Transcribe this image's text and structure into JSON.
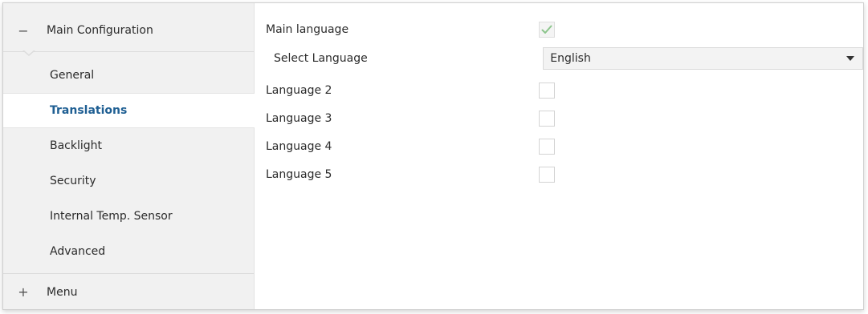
{
  "sidebar": {
    "main_group": {
      "sign": "−",
      "label": "Main Configuration"
    },
    "items": [
      {
        "label": "General",
        "active": false
      },
      {
        "label": "Translations",
        "active": true
      },
      {
        "label": "Backlight",
        "active": false
      },
      {
        "label": "Security",
        "active": false
      },
      {
        "label": "Internal Temp. Sensor",
        "active": false
      },
      {
        "label": "Advanced",
        "active": false
      }
    ],
    "menu_group": {
      "sign": "+",
      "label": "Menu"
    }
  },
  "content": {
    "main_language": {
      "label": "Main language",
      "checked": true
    },
    "select_language": {
      "label": "Select Language",
      "value": "English"
    },
    "languages": [
      {
        "label": "Language 2",
        "checked": false
      },
      {
        "label": "Language 3",
        "checked": false
      },
      {
        "label": "Language 4",
        "checked": false
      },
      {
        "label": "Language 5",
        "checked": false
      }
    ]
  },
  "colors": {
    "active_item": "#1f5f93",
    "check_green": "#8cc58c"
  }
}
